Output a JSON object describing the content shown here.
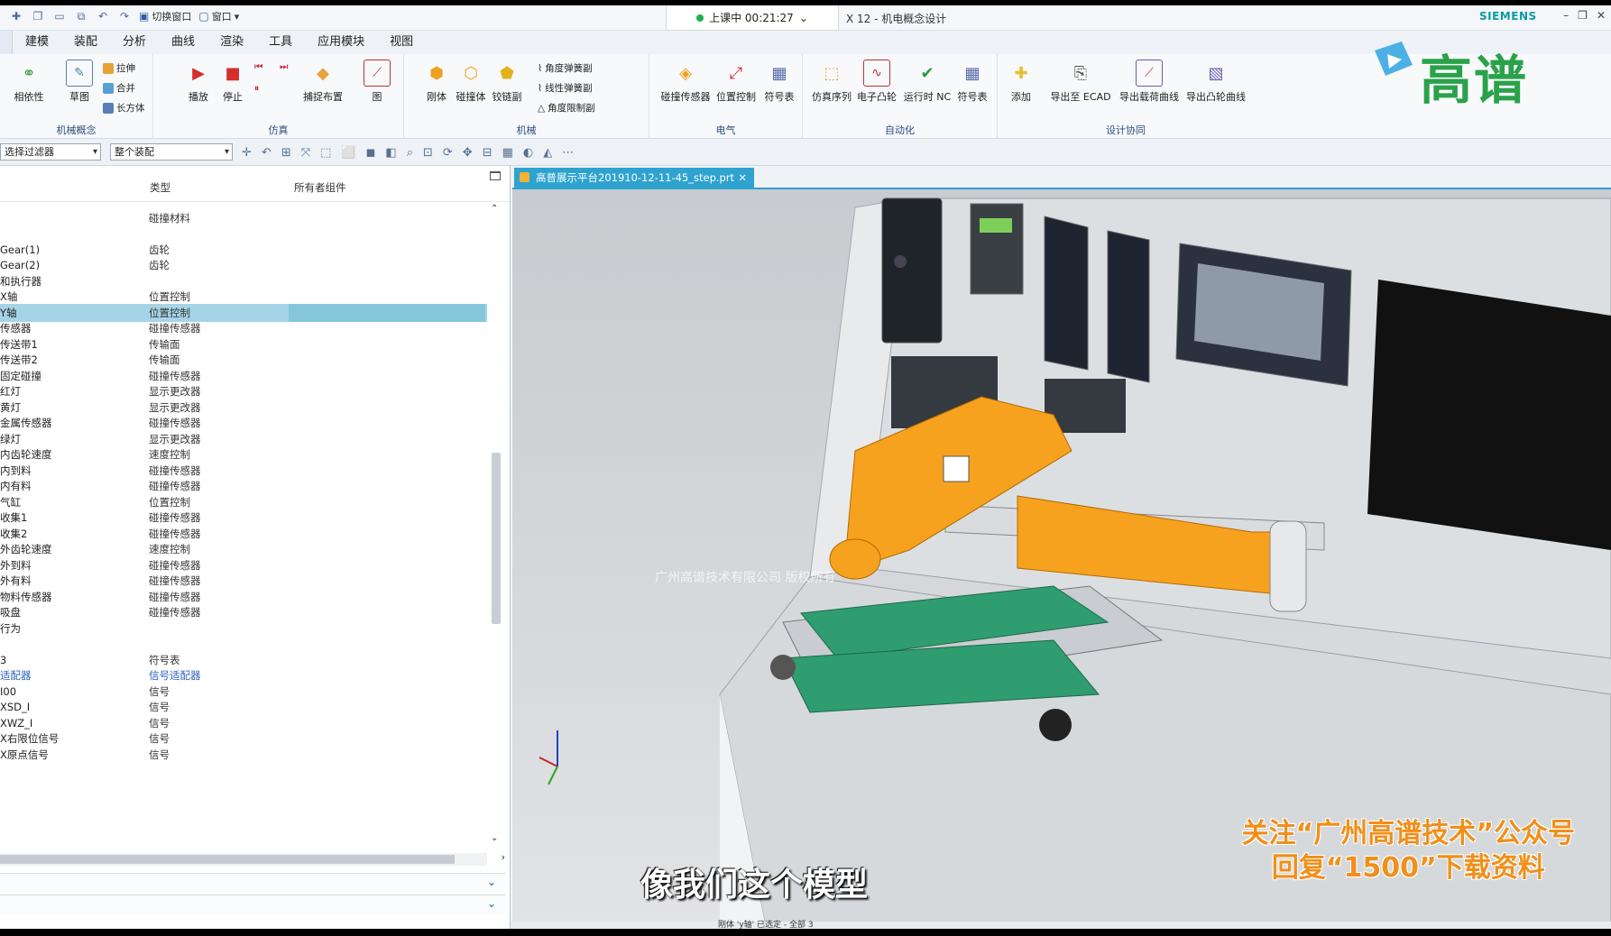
{
  "title_bar": {
    "quick_access": [
      "切换窗口",
      "窗口"
    ],
    "session_status": "上课中 00:21:27",
    "document_title": "X 12 - 机电概念设计",
    "brand": "SIEMENS"
  },
  "menu": [
    "建模",
    "装配",
    "分析",
    "曲线",
    "渲染",
    "工具",
    "应用模块",
    "视图"
  ],
  "ribbon": {
    "groups": [
      {
        "label": "机械概念",
        "buttons": [
          "相依性",
          "草图"
        ],
        "small": [
          "拉伸",
          "合并",
          "长方体"
        ]
      },
      {
        "label": "仿真",
        "buttons": [
          "播放",
          "停止",
          "捕捉布置",
          "图"
        ]
      },
      {
        "label": "机械",
        "buttons": [
          "刚体",
          "碰撞体",
          "铰链副"
        ],
        "small": [
          "角度弹簧副",
          "线性弹簧副",
          "角度限制副"
        ]
      },
      {
        "label": "电气",
        "buttons": [
          "碰撞传感器",
          "位置控制",
          "符号表"
        ]
      },
      {
        "label": "自动化",
        "buttons": [
          "仿真序列",
          "电子凸轮",
          "运行时 NC",
          "符号表"
        ]
      },
      {
        "label": "设计协同",
        "buttons": [
          "添加",
          "导出至 ECAD",
          "导出载荷曲线",
          "导出凸轮曲线"
        ]
      }
    ]
  },
  "selection_bar": {
    "filter": "选择过滤器",
    "scope": "整个装配"
  },
  "navigator": {
    "columns": [
      "类型",
      "所有者组件"
    ],
    "rows": [
      {
        "name": "",
        "type": "碰撞材料"
      },
      {
        "name": "Gear(1)",
        "type": "齿轮"
      },
      {
        "name": "Gear(2)",
        "type": "齿轮"
      },
      {
        "name": "和执行器",
        "type": ""
      },
      {
        "name": "X轴",
        "type": "位置控制"
      },
      {
        "name": "Y轴",
        "type": "位置控制",
        "selected": true
      },
      {
        "name": "传感器",
        "type": "碰撞传感器"
      },
      {
        "name": "传送带1",
        "type": "传输面"
      },
      {
        "name": "传送带2",
        "type": "传输面"
      },
      {
        "name": "固定碰撞",
        "type": "碰撞传感器"
      },
      {
        "name": "红灯",
        "type": "显示更改器"
      },
      {
        "name": "黄灯",
        "type": "显示更改器"
      },
      {
        "name": "金属传感器",
        "type": "碰撞传感器"
      },
      {
        "name": "绿灯",
        "type": "显示更改器"
      },
      {
        "name": "内齿轮速度",
        "type": "速度控制"
      },
      {
        "name": "内到料",
        "type": "碰撞传感器"
      },
      {
        "name": "内有料",
        "type": "碰撞传感器"
      },
      {
        "name": "气缸",
        "type": "位置控制"
      },
      {
        "name": "收集1",
        "type": "碰撞传感器"
      },
      {
        "name": "收集2",
        "type": "碰撞传感器"
      },
      {
        "name": "外齿轮速度",
        "type": "速度控制"
      },
      {
        "name": "外到料",
        "type": "碰撞传感器"
      },
      {
        "name": "外有料",
        "type": "碰撞传感器"
      },
      {
        "name": "物料传感器",
        "type": "碰撞传感器"
      },
      {
        "name": "吸盘",
        "type": "碰撞传感器"
      },
      {
        "name": "行为",
        "type": ""
      },
      {
        "name": "",
        "type": ""
      },
      {
        "name": "3",
        "type": "符号表"
      },
      {
        "name": "适配器",
        "type": "信号适配器",
        "link": true
      },
      {
        "name": "I00",
        "type": "信号"
      },
      {
        "name": "XSD_I",
        "type": "信号"
      },
      {
        "name": "XWZ_I",
        "type": "信号"
      },
      {
        "name": "X右限位信号",
        "type": "信号"
      },
      {
        "name": "X原点信号",
        "type": "信号"
      }
    ]
  },
  "doc_tab": "高普展示平台201910-12-11-45_step.prt",
  "status_text": "刚体 'y轴' 已选定 - 全部 3",
  "overlay": {
    "logo_text": "高谱",
    "watermark": "广州高谱技术有限公司 版权所有",
    "promo_line1": "关注“广州高谱技术”公众号",
    "promo_line2": "回复“1500”下载资料",
    "subtitle": "像我们这个模型"
  },
  "colors": {
    "accent": "#2ea3cf",
    "robot": "#f7a21e",
    "belt": "#2f9d6f",
    "promo": "#f08f1a",
    "selection": "#a5d4e6"
  }
}
